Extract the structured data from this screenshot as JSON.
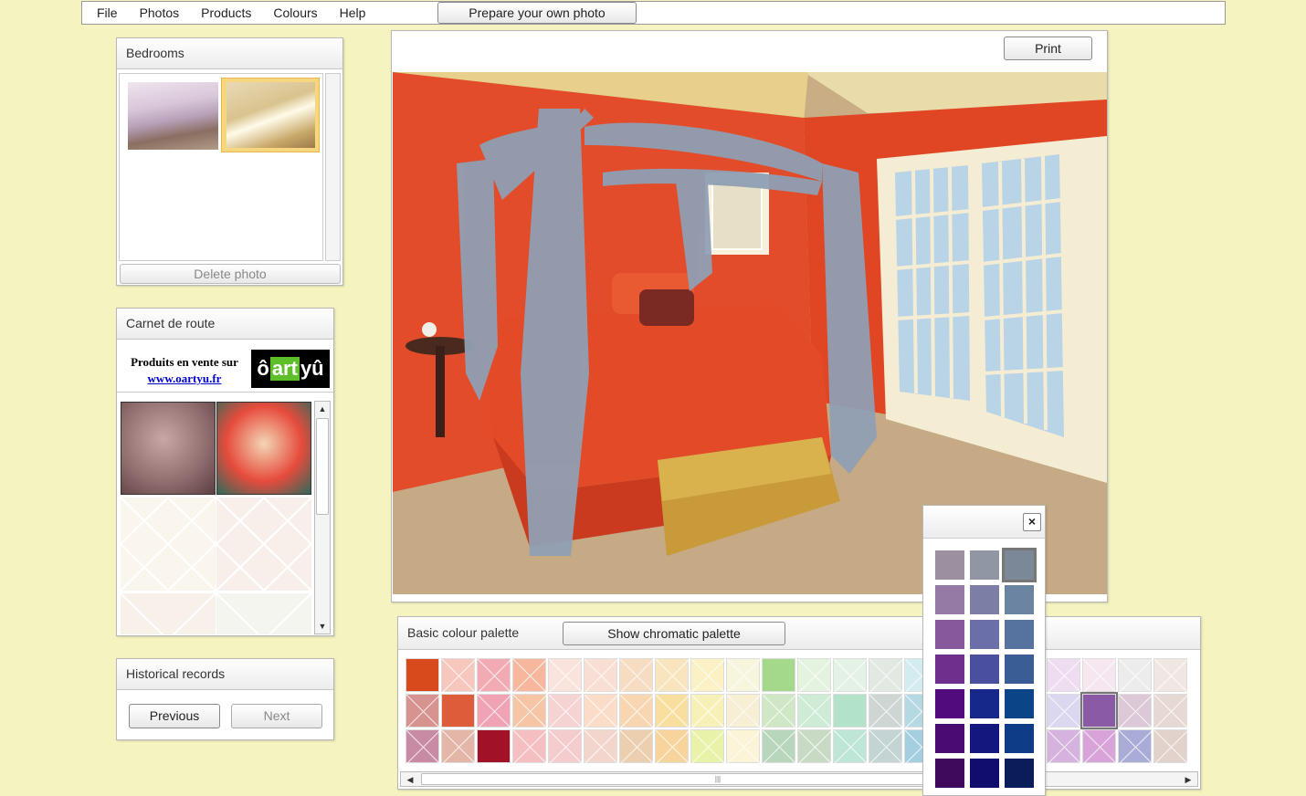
{
  "menu": {
    "items": [
      "File",
      "Photos",
      "Products",
      "Colours",
      "Help"
    ],
    "prepare_label": "Prepare your own photo"
  },
  "bedrooms": {
    "title": "Bedrooms",
    "delete_label": "Delete photo"
  },
  "carnet": {
    "title": "Carnet de route",
    "ad_line1": "Produits en vente sur",
    "ad_link": "www.oartyu.fr",
    "logo_pre": "ô",
    "logo_mid": "art",
    "logo_post": "yû"
  },
  "history": {
    "title": "Historical records",
    "previous_label": "Previous",
    "next_label": "Next"
  },
  "viewer": {
    "print_label": "Print"
  },
  "palette": {
    "title": "Basic colour palette",
    "chromatic_label": "Show chromatic palette",
    "rows": [
      [
        "#d84a1c",
        "#f7c7bd",
        "#f2aab3",
        "#f6b79c",
        "#fae3dc",
        "#f8ded3",
        "#f6dcc1",
        "#f9e5bd",
        "#fbf1c4",
        "#f7f5dc",
        "#a4d98b",
        "#e3f3df",
        "#e4f2e6",
        "#e2e8e2",
        "#d3ecf0",
        "#d9e3ef",
        "#e4e4ee",
        "#e2e0f0",
        "#eedcf0",
        "#f5e6f0",
        "#ececec",
        "#f0e6e2"
      ],
      [
        "#d7938f",
        "#de5c3a",
        "#f0a3b2",
        "#f6c5a6",
        "#f6d3d3",
        "#fbdcc9",
        "#f8d6b1",
        "#f9df9f",
        "#f7f1b7",
        "#f6efd3",
        "#cfe7c4",
        "#cdebd5",
        "#b2e3c8",
        "#cdd6d2",
        "#b5d9e3",
        "#c3d2e6",
        "#ccd3ea",
        "#cccfe8",
        "#dcd7f0",
        "#8a5aa6",
        "#ddc8d8",
        "#e6d9d3"
      ],
      [
        "#c98aa5",
        "#e3b6a8",
        "#a11227",
        "#f5bfc1",
        "#f4cccd",
        "#f3d6cb",
        "#ebcfae",
        "#f6d49b",
        "#e8f2a8",
        "#fbf4d6",
        "#b7d6bc",
        "#c9dac4",
        "#bde6d7",
        "#c4d3d3",
        "#a4cfe0",
        "#b3c4de",
        "#bcc4e0",
        "#c8c9e4",
        "#d5b3de",
        "#d7a3d9",
        "#a9acd7",
        "#e1d2cc"
      ]
    ]
  },
  "popup": {
    "close_label": "×",
    "rows": [
      [
        "#9b8fa0",
        "#9096a4",
        "#7b8898"
      ],
      [
        "#957aa6",
        "#7d7ea6",
        "#6b84a2"
      ],
      [
        "#87589c",
        "#6a6ea9",
        "#56729e"
      ],
      [
        "#6f2f8c",
        "#4a4f9e",
        "#3a5d95"
      ],
      [
        "#520b7c",
        "#16298a",
        "#0c4587"
      ],
      [
        "#4a0c70",
        "#14187e",
        "#0e3c86"
      ],
      [
        "#3f0a5b",
        "#110d6f",
        "#0a1c5a"
      ]
    ],
    "selected": "#7b8898"
  }
}
